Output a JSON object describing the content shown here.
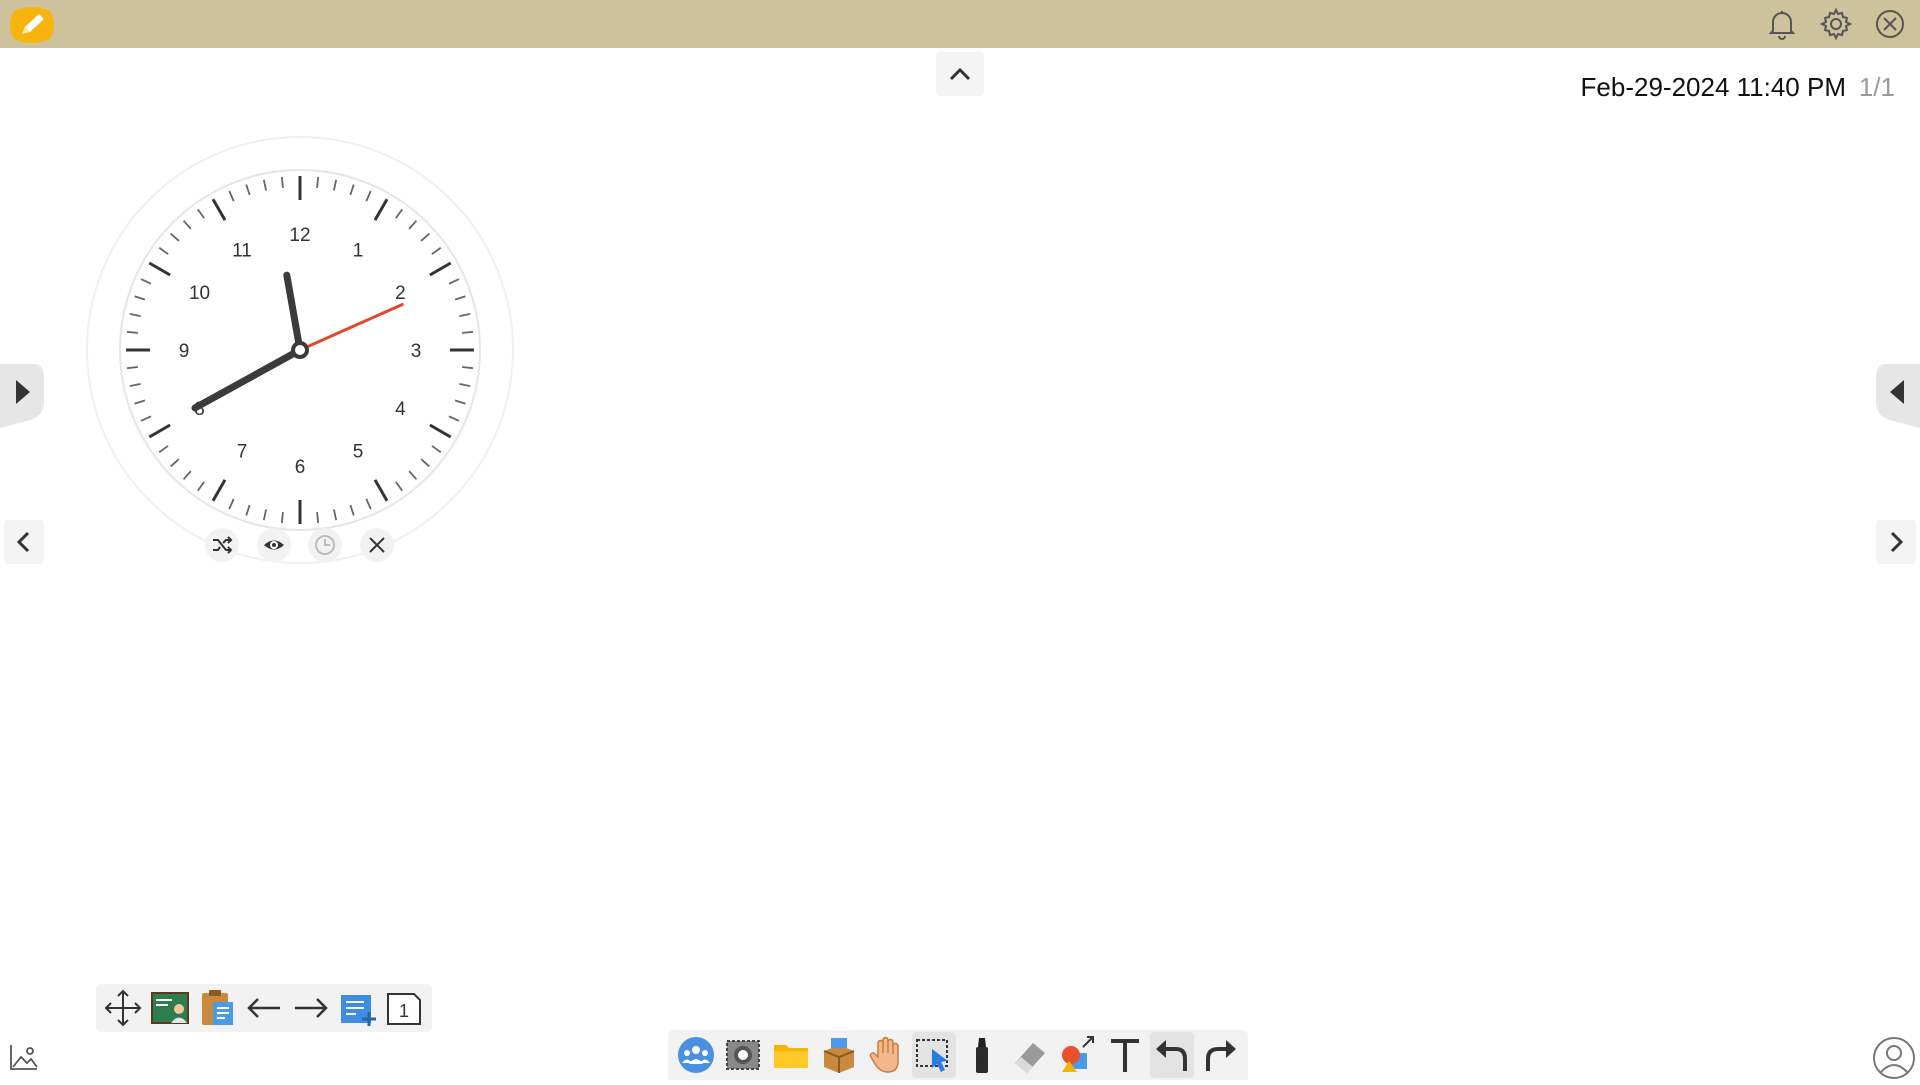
{
  "header": {
    "app_icon": "pencil-logo-icon",
    "right_icons": [
      "bell-icon",
      "gear-icon",
      "close-circle-icon"
    ]
  },
  "status": {
    "datetime": "Feb-29-2024 11:40 PM",
    "page_count": "1/1"
  },
  "clock": {
    "numbers": [
      "12",
      "1",
      "2",
      "3",
      "4",
      "5",
      "6",
      "7",
      "8",
      "9",
      "10",
      "11"
    ],
    "time": {
      "hour": 11,
      "minute": 40,
      "second": 11
    },
    "second_hand_color": "#e0492a",
    "controls": [
      "shuffle-icon",
      "eye-icon",
      "clock-icon",
      "close-icon"
    ]
  },
  "page_toolbar": {
    "items": [
      "move-icon",
      "whiteboard-icon",
      "clipboard-icon",
      "arrow-left-icon",
      "arrow-right-icon",
      "add-page-icon",
      "page-number-icon"
    ],
    "page_number": "1"
  },
  "main_toolbar": {
    "items": [
      "group-icon",
      "capture-icon",
      "folder-icon",
      "toolbox-icon",
      "hand-icon",
      "select-icon",
      "marker-icon",
      "eraser-icon",
      "shapes-icon",
      "text-icon",
      "undo-icon",
      "redo-icon"
    ]
  }
}
